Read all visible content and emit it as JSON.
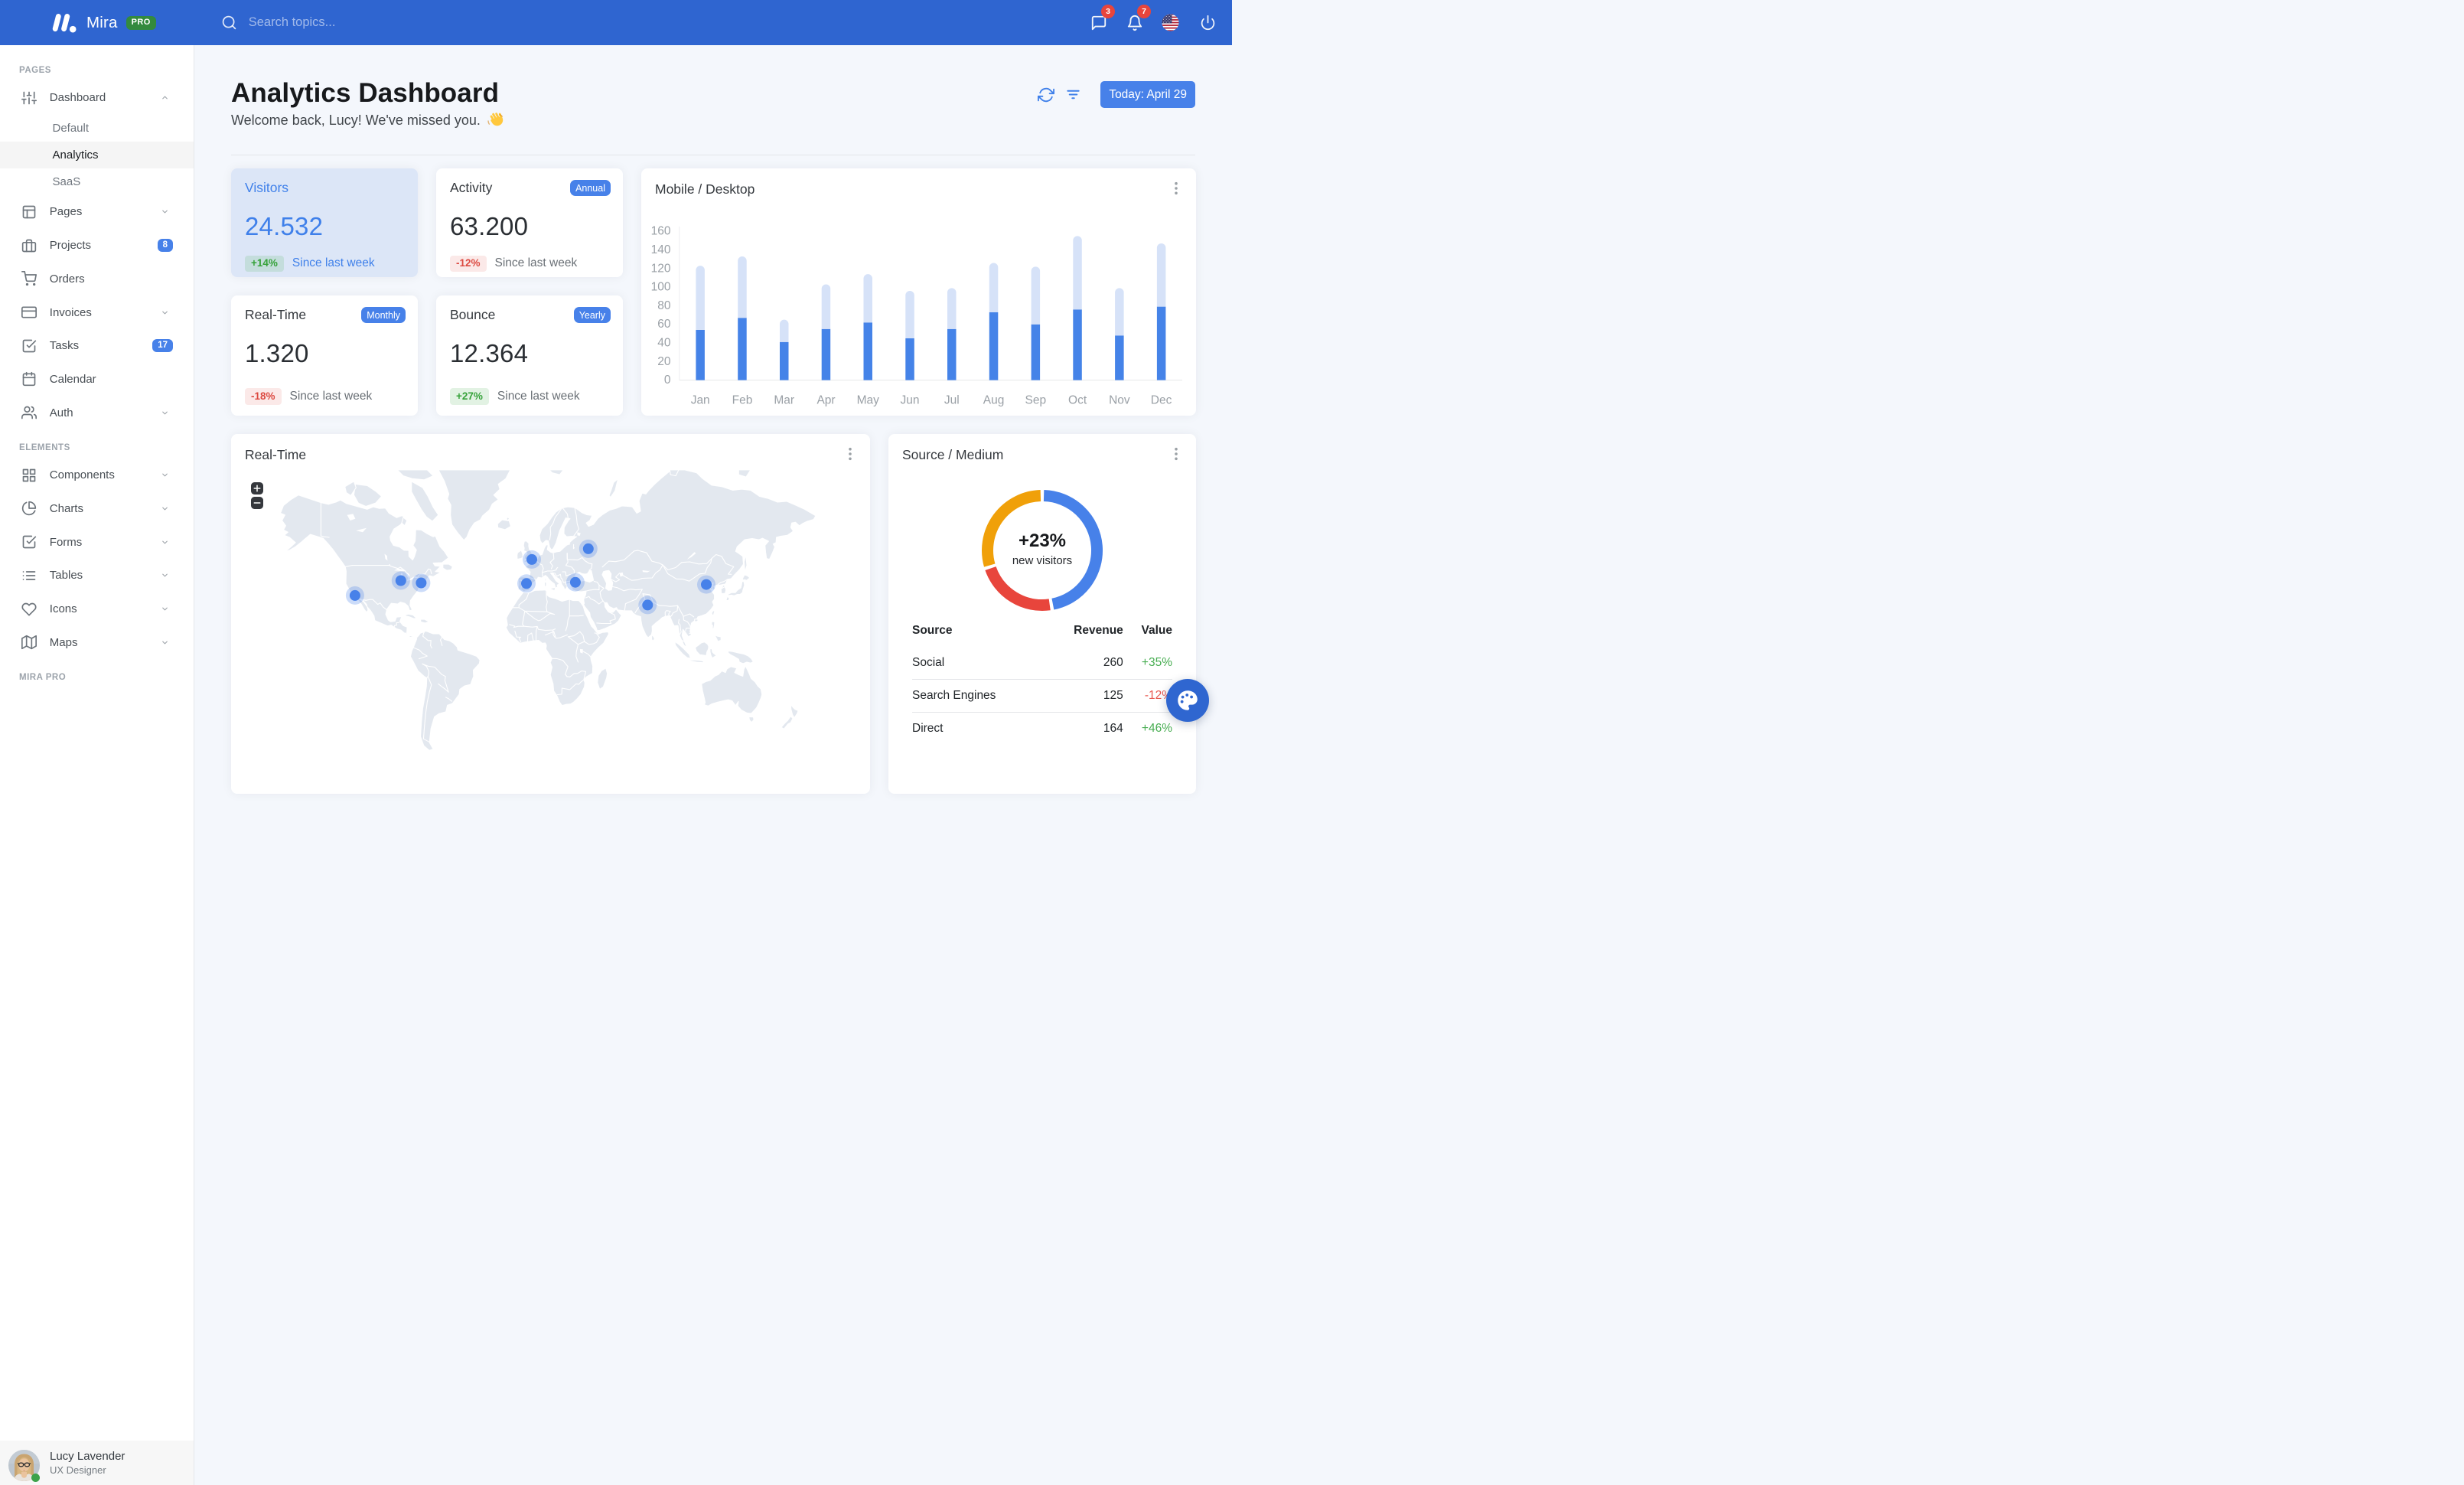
{
  "theme": {
    "navbar_blue": "#2F65D0",
    "primary": "#3F80EA",
    "button_blue": "#4781E9",
    "success_green": "#36A23A",
    "danger_red": "#DC4A41",
    "badge_red": "#E8453C",
    "bar_light_blue": "#D6E2F8",
    "donut_colors": [
      "#4781E9",
      "#E8453C",
      "#F0A009"
    ]
  },
  "navbar": {
    "brand": "Mira",
    "brand_badge": "PRO",
    "search_placeholder": "Search topics...",
    "messages_count": "3",
    "notifications_count": "7",
    "language": "us-flag",
    "icons": [
      "message-square-icon",
      "bell-icon",
      "us-flag-icon",
      "power-icon"
    ]
  },
  "sidebar": {
    "sections": [
      {
        "label": "PAGES",
        "items": [
          {
            "label": "Dashboard",
            "icon": "sliders-icon",
            "chevron": "up",
            "expanded": true,
            "children": [
              {
                "label": "Default",
                "active": false
              },
              {
                "label": "Analytics",
                "active": true
              },
              {
                "label": "SaaS",
                "active": false
              }
            ]
          },
          {
            "label": "Pages",
            "icon": "layout-icon",
            "chevron": "down"
          },
          {
            "label": "Projects",
            "icon": "briefcase-icon",
            "badge": "8"
          },
          {
            "label": "Orders",
            "icon": "shopping-cart-icon"
          },
          {
            "label": "Invoices",
            "icon": "credit-card-icon",
            "chevron": "down"
          },
          {
            "label": "Tasks",
            "icon": "check-square-icon",
            "badge": "17"
          },
          {
            "label": "Calendar",
            "icon": "calendar-icon"
          },
          {
            "label": "Auth",
            "icon": "users-icon",
            "chevron": "down"
          }
        ]
      },
      {
        "label": "ELEMENTS",
        "items": [
          {
            "label": "Components",
            "icon": "grid-icon",
            "chevron": "down"
          },
          {
            "label": "Charts",
            "icon": "pie-chart-icon",
            "chevron": "down"
          },
          {
            "label": "Forms",
            "icon": "check-square-icon",
            "chevron": "down"
          },
          {
            "label": "Tables",
            "icon": "list-icon",
            "chevron": "down"
          },
          {
            "label": "Icons",
            "icon": "heart-icon",
            "chevron": "down"
          },
          {
            "label": "Maps",
            "icon": "map-icon",
            "chevron": "down"
          }
        ]
      },
      {
        "label": "MIRA PRO",
        "items": []
      }
    ],
    "user": {
      "name": "Lucy Lavender",
      "role": "UX Designer",
      "status": "online",
      "avatar_icon": "avatar-lucy"
    }
  },
  "header": {
    "title": "Analytics Dashboard",
    "subtitle": "Welcome back, Lucy! We've missed you.",
    "wave_emoji": "waving-hand",
    "date_button": "Today: April 29",
    "actions": [
      "refresh-icon",
      "filter-icon"
    ]
  },
  "stats": [
    {
      "title": "Visitors",
      "value": "24.532",
      "change": "+14%",
      "trend": "up",
      "period": "Since last week",
      "highlight": true,
      "badge": ""
    },
    {
      "title": "Activity",
      "value": "63.200",
      "change": "-12%",
      "trend": "down",
      "period": "Since last week",
      "highlight": false,
      "badge": "Annual"
    },
    {
      "title": "Real-Time",
      "value": "1.320",
      "change": "-18%",
      "trend": "down",
      "period": "Since last week",
      "highlight": false,
      "badge": "Monthly"
    },
    {
      "title": "Bounce",
      "value": "12.364",
      "change": "+27%",
      "trend": "up",
      "period": "Since last week",
      "highlight": false,
      "badge": "Yearly"
    }
  ],
  "chart_data": [
    {
      "type": "bar",
      "title": "Mobile / Desktop",
      "stacked": true,
      "categories": [
        "Jan",
        "Feb",
        "Mar",
        "Apr",
        "May",
        "Jun",
        "Jul",
        "Aug",
        "Sep",
        "Oct",
        "Nov",
        "Dec"
      ],
      "series": [
        {
          "name": "Mobile",
          "color": "#4583E8",
          "values": [
            54,
            67,
            41,
            55,
            62,
            45,
            55,
            73,
            60,
            76,
            48,
            79
          ]
        },
        {
          "name": "Desktop",
          "color": "#D6E2F8",
          "values": [
            69,
            66,
            24,
            48,
            52,
            51,
            44,
            53,
            62,
            79,
            51,
            68
          ]
        }
      ],
      "ylabel": "",
      "xlabel": "",
      "ylim": [
        0,
        160
      ],
      "ytick_step": 20,
      "grid": false,
      "legend": "none"
    },
    {
      "type": "pie",
      "title": "Source / Medium",
      "donut": true,
      "center_label": "+23%",
      "center_sublabel": "new visitors",
      "labels": [
        "Social",
        "Search Engines",
        "Direct"
      ],
      "values": [
        260,
        125,
        164
      ],
      "colors": [
        "#4781E9",
        "#E8453C",
        "#F0A009"
      ],
      "start_angle": "top",
      "direction": "clockwise"
    },
    {
      "type": "map",
      "title": "Real-Time",
      "markers": [
        {
          "name": "Los Angeles",
          "lat": 34.05,
          "lon": -118.24
        },
        {
          "name": "Chicago",
          "lat": 41.88,
          "lon": -87.63
        },
        {
          "name": "New York",
          "lat": 40.71,
          "lon": -74.01
        },
        {
          "name": "London",
          "lat": 51.51,
          "lon": -0.13
        },
        {
          "name": "Madrid",
          "lat": 40.42,
          "lon": -3.7
        },
        {
          "name": "Istanbul",
          "lat": 41.01,
          "lon": 28.98
        },
        {
          "name": "Moscow",
          "lat": 55.75,
          "lon": 37.62
        },
        {
          "name": "New Delhi",
          "lat": 28.61,
          "lon": 77.21
        },
        {
          "name": "Beijing",
          "lat": 39.9,
          "lon": 116.41
        }
      ]
    }
  ],
  "source_table": {
    "columns": [
      "Source",
      "Revenue",
      "Value"
    ],
    "rows": [
      {
        "source": "Social",
        "revenue": "260",
        "value": "+35%",
        "trend": "up"
      },
      {
        "source": "Search Engines",
        "revenue": "125",
        "value": "-12%",
        "trend": "down"
      },
      {
        "source": "Direct",
        "revenue": "164",
        "value": "+46%",
        "trend": "up"
      }
    ]
  },
  "fab": {
    "icon": "palette-icon"
  },
  "map_controls": {
    "zoom_in_icon": "plus-icon",
    "zoom_out_icon": "minus-icon"
  },
  "card_menu_icon": "dots-icon"
}
